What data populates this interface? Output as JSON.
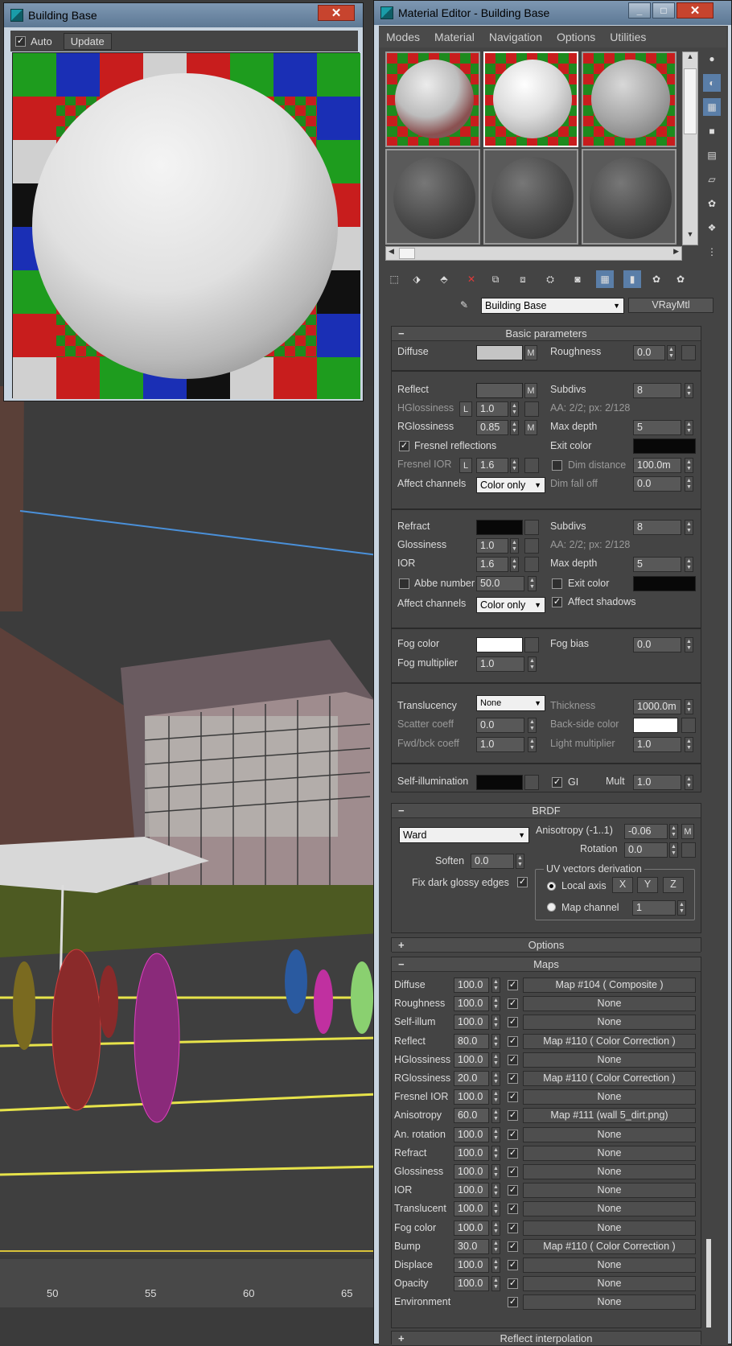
{
  "preview_window": {
    "title": "Building Base",
    "close": "✕",
    "auto_label": "Auto",
    "update_label": "Update"
  },
  "editor": {
    "title": "Material Editor - Building Base",
    "close": "✕",
    "menu": [
      "Modes",
      "Material",
      "Navigation",
      "Options",
      "Utilities"
    ],
    "material_name": "Building Base",
    "material_type": "VRayMtl"
  },
  "basic": {
    "header": "Basic parameters",
    "diffuse_label": "Diffuse",
    "m": "M",
    "roughness_label": "Roughness",
    "roughness_value": "0.0",
    "reflect_label": "Reflect",
    "subdivs_label": "Subdivs",
    "reflect_subdivs": "8",
    "hgloss_label": "HGlossiness",
    "l": "L",
    "hgloss_value": "1.0",
    "aa_text": "AA: 2/2; px: 2/128",
    "rgloss_label": "RGlossiness",
    "rgloss_value": "0.85",
    "maxdepth_label": "Max depth",
    "reflect_maxdepth": "5",
    "fresnel_label": "Fresnel reflections",
    "exit_color_label": "Exit color",
    "fresnel_ior_label": "Fresnel IOR",
    "fresnel_ior_value": "1.6",
    "dim_distance_label": "Dim distance",
    "dim_distance_value": "100.0m",
    "affect_channels_label": "Affect channels",
    "affect_channels_value": "Color only",
    "dim_falloff_label": "Dim fall off",
    "dim_falloff_value": "0.0",
    "refract_label": "Refract",
    "refract_subdivs": "8",
    "glossiness_label": "Glossiness",
    "glossiness_value": "1.0",
    "ior_label": "IOR",
    "ior_value": "1.6",
    "refract_maxdepth": "5",
    "abbe_label": "Abbe number",
    "abbe_value": "50.0",
    "refract_exit_label": "Exit color",
    "refract_affect_value": "Color only",
    "affect_shadows_label": "Affect shadows",
    "fog_color_label": "Fog color",
    "fog_bias_label": "Fog bias",
    "fog_bias_value": "0.0",
    "fog_mult_label": "Fog multiplier",
    "fog_mult_value": "1.0",
    "translucency_label": "Translucency",
    "translucency_value": "None",
    "thickness_label": "Thickness",
    "thickness_value": "1000.0m",
    "scatter_label": "Scatter coeff",
    "scatter_value": "0.0",
    "backside_label": "Back-side color",
    "fwdbck_label": "Fwd/bck coeff",
    "fwdbck_value": "1.0",
    "lightmult_label": "Light multiplier",
    "lightmult_value": "1.0",
    "selfillum_label": "Self-illumination",
    "gi_label": "GI",
    "mult_label": "Mult",
    "mult_value": "1.0"
  },
  "brdf": {
    "header": "BRDF",
    "type": "Ward",
    "anisotropy_label": "Anisotropy (-1..1)",
    "anisotropy_value": "-0.06",
    "m": "M",
    "rotation_label": "Rotation",
    "rotation_value": "0.0",
    "soften_label": "Soften",
    "soften_value": "0.0",
    "uv_group": "UV vectors derivation",
    "local_axis": "Local axis",
    "x": "X",
    "y": "Y",
    "z": "Z",
    "fix_dark_label": "Fix dark glossy edges",
    "map_channel_label": "Map channel",
    "map_channel_value": "1"
  },
  "options": {
    "header": "Options",
    "pm": "+"
  },
  "maps": {
    "header": "Maps",
    "pm": "−",
    "rows": [
      {
        "label": "Diffuse",
        "amount": "100.0",
        "map": "Map #104  ( Composite )"
      },
      {
        "label": "Roughness",
        "amount": "100.0",
        "map": "None"
      },
      {
        "label": "Self-illum",
        "amount": "100.0",
        "map": "None"
      },
      {
        "label": "Reflect",
        "amount": "80.0",
        "map": "Map #110  ( Color Correction )"
      },
      {
        "label": "HGlossiness",
        "amount": "100.0",
        "map": "None"
      },
      {
        "label": "RGlossiness",
        "amount": "20.0",
        "map": "Map #110  ( Color Correction )"
      },
      {
        "label": "Fresnel IOR",
        "amount": "100.0",
        "map": "None"
      },
      {
        "label": "Anisotropy",
        "amount": "60.0",
        "map": "Map #111 (wall 5_dirt.png)"
      },
      {
        "label": "An. rotation",
        "amount": "100.0",
        "map": "None"
      },
      {
        "label": "Refract",
        "amount": "100.0",
        "map": "None"
      },
      {
        "label": "Glossiness",
        "amount": "100.0",
        "map": "None"
      },
      {
        "label": "IOR",
        "amount": "100.0",
        "map": "None"
      },
      {
        "label": "Translucent",
        "amount": "100.0",
        "map": "None"
      },
      {
        "label": "Fog color",
        "amount": "100.0",
        "map": "None"
      },
      {
        "label": "Bump",
        "amount": "30.0",
        "map": "Map #110  ( Color Correction )"
      },
      {
        "label": "Displace",
        "amount": "100.0",
        "map": "None"
      },
      {
        "label": "Opacity",
        "amount": "100.0",
        "map": "None"
      },
      {
        "label": "Environment",
        "amount": "",
        "map": "None"
      }
    ]
  },
  "reflect_interp": {
    "header": "Reflect interpolation",
    "pm": "+"
  },
  "timeline": {
    "ticks": [
      "50",
      "55",
      "60",
      "65"
    ]
  },
  "colors": {
    "titlebar": "#6f8aa6",
    "panel": "#444444",
    "close": "#c7442e"
  }
}
